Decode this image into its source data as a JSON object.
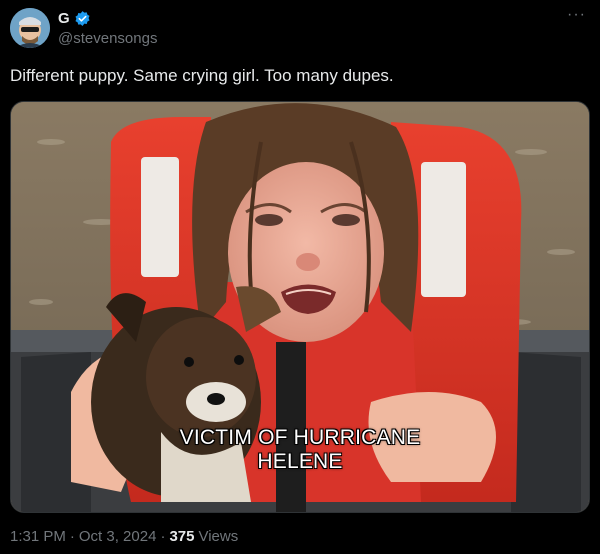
{
  "author": {
    "display_name": "G",
    "handle": "@stevensongs",
    "avatar_icon": "avatar-icon",
    "verified_color": "#1d9bf0"
  },
  "tweet": {
    "text": "Different puppy. Same crying girl. Too many dupes.",
    "media_caption_line1": "VICTIM OF HURRICANE",
    "media_caption_line2": "HELENE"
  },
  "meta": {
    "time": "1:31 PM",
    "separator1": "·",
    "date": "Oct 3, 2024",
    "separator2": "·",
    "views_count": "375",
    "views_label": "Views"
  },
  "more_icon": "···"
}
